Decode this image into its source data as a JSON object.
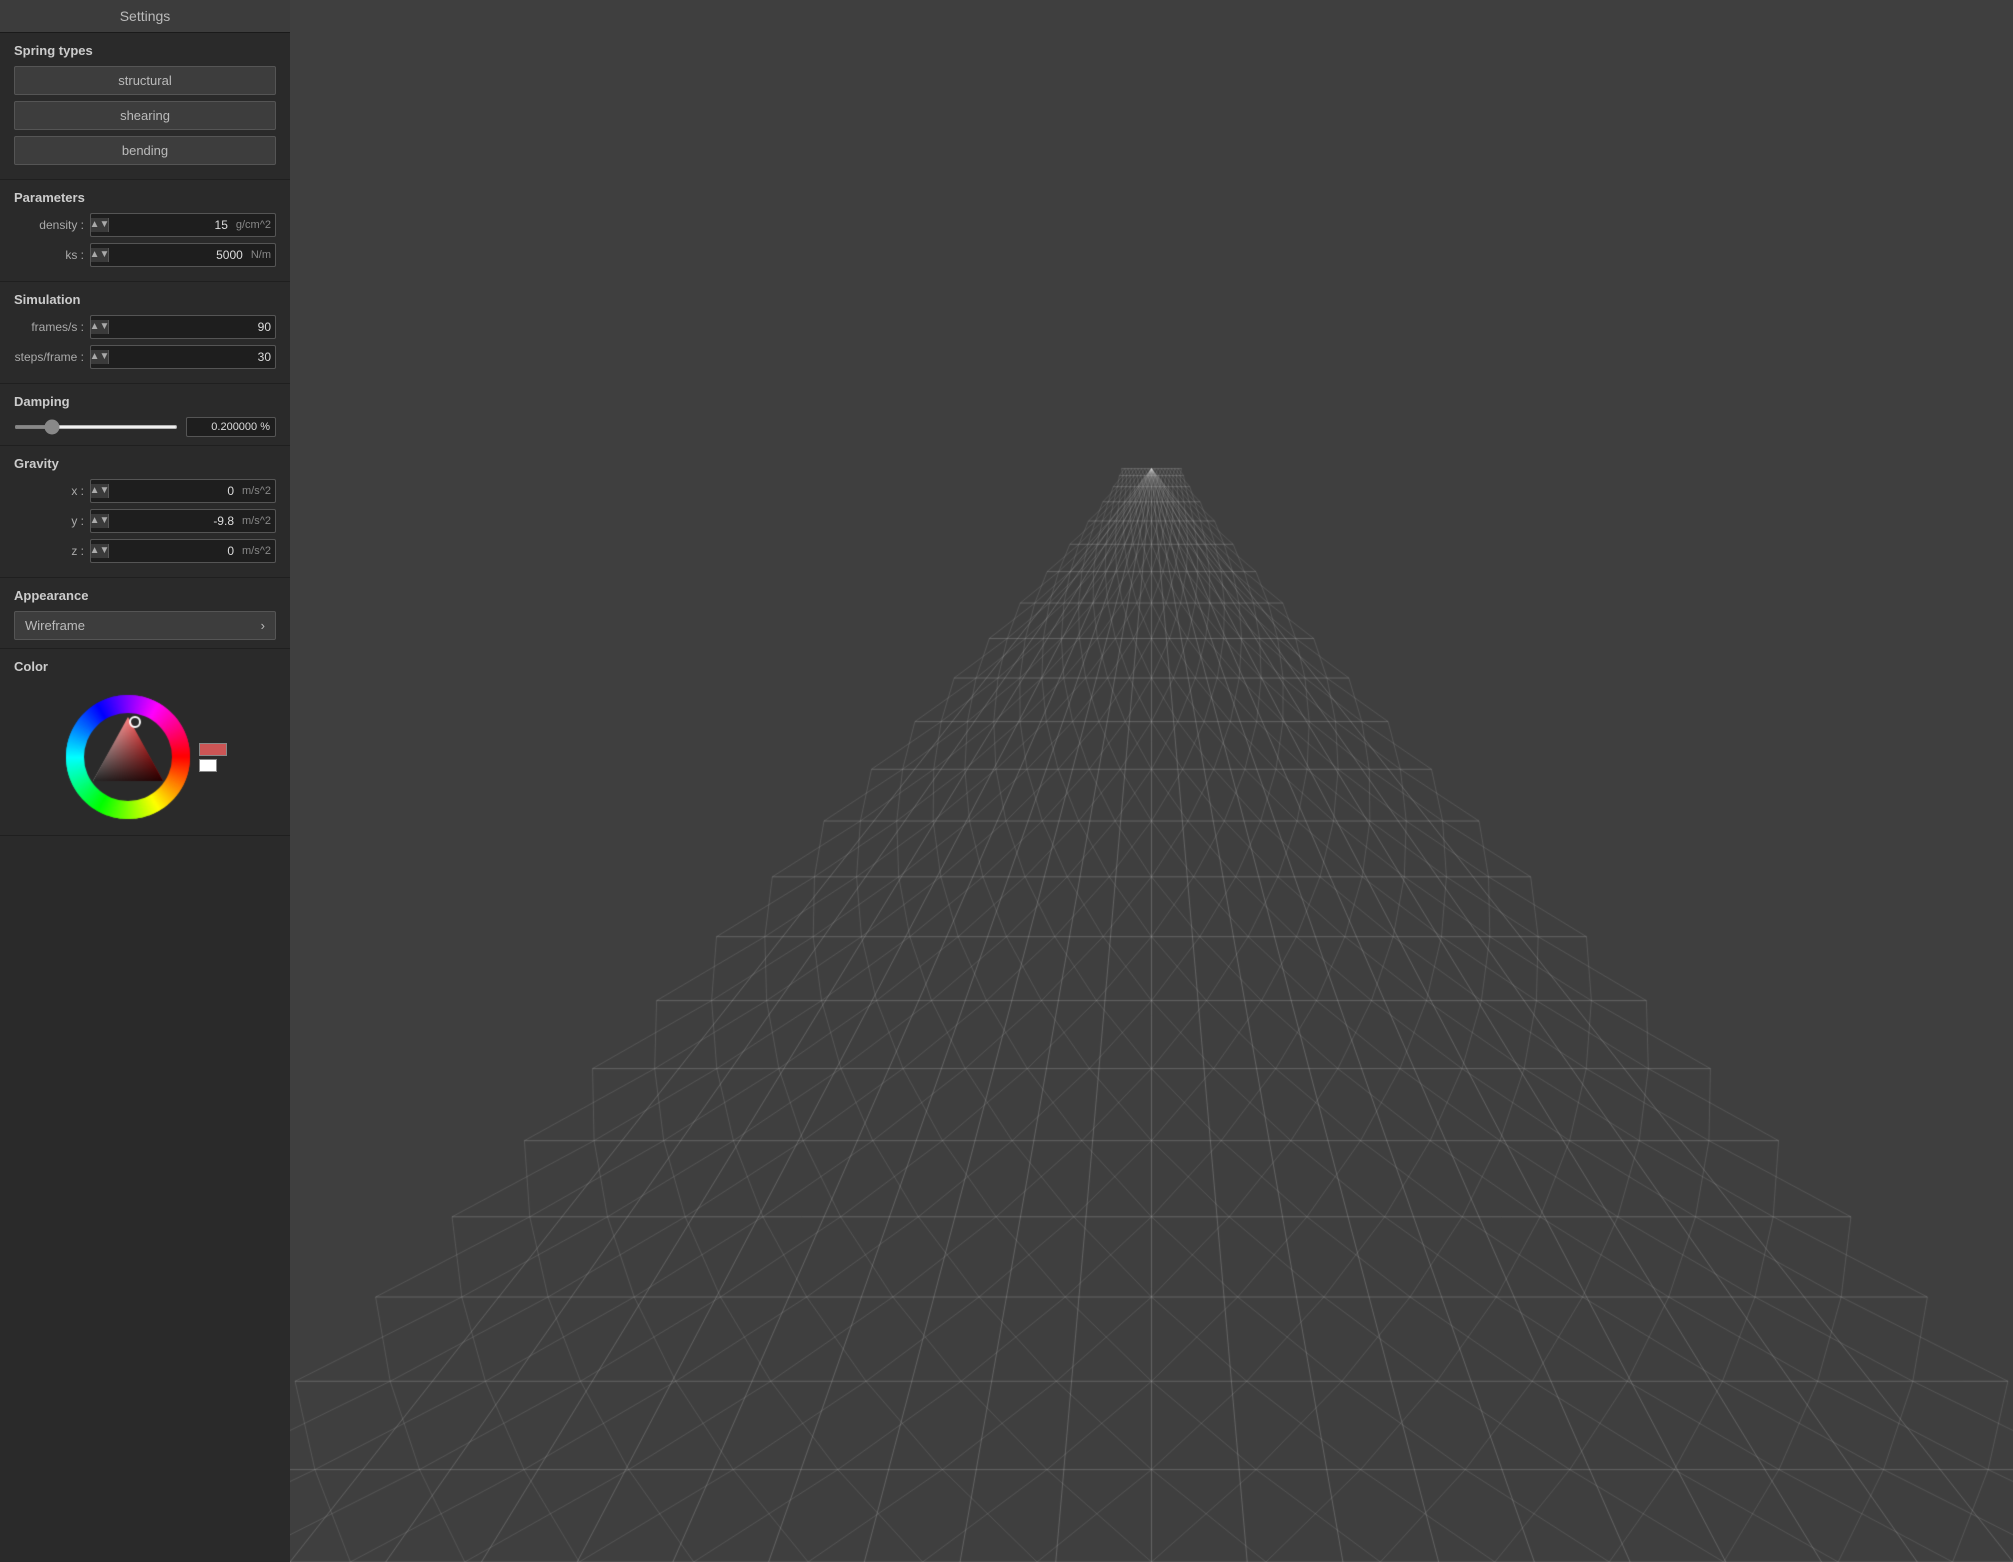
{
  "sidebar": {
    "title": "Settings",
    "spring_types": {
      "label": "Spring types",
      "buttons": [
        {
          "id": "structural",
          "label": "structural"
        },
        {
          "id": "shearing",
          "label": "shearing"
        },
        {
          "id": "bending",
          "label": "bending"
        }
      ]
    },
    "parameters": {
      "label": "Parameters",
      "fields": [
        {
          "id": "density",
          "label": "density :",
          "value": "15",
          "unit": "g/cm^2"
        },
        {
          "id": "ks",
          "label": "ks :",
          "value": "5000",
          "unit": "N/m"
        }
      ]
    },
    "simulation": {
      "label": "Simulation",
      "fields": [
        {
          "id": "frames_s",
          "label": "frames/s :",
          "value": "90",
          "unit": ""
        },
        {
          "id": "steps_frame",
          "label": "steps/frame :",
          "value": "30",
          "unit": ""
        }
      ]
    },
    "damping": {
      "label": "Damping",
      "value": 0.2,
      "display": "0.200000 %",
      "min": 0,
      "max": 1
    },
    "gravity": {
      "label": "Gravity",
      "fields": [
        {
          "id": "gx",
          "label": "x :",
          "value": "0",
          "unit": "m/s^2"
        },
        {
          "id": "gy",
          "label": "y :",
          "value": "-9.8",
          "unit": "m/s^2"
        },
        {
          "id": "gz",
          "label": "z :",
          "value": "0",
          "unit": "m/s^2"
        }
      ]
    },
    "appearance": {
      "label": "Appearance",
      "wireframe_label": "Wireframe",
      "chevron": "›"
    },
    "color": {
      "label": "Color"
    }
  }
}
